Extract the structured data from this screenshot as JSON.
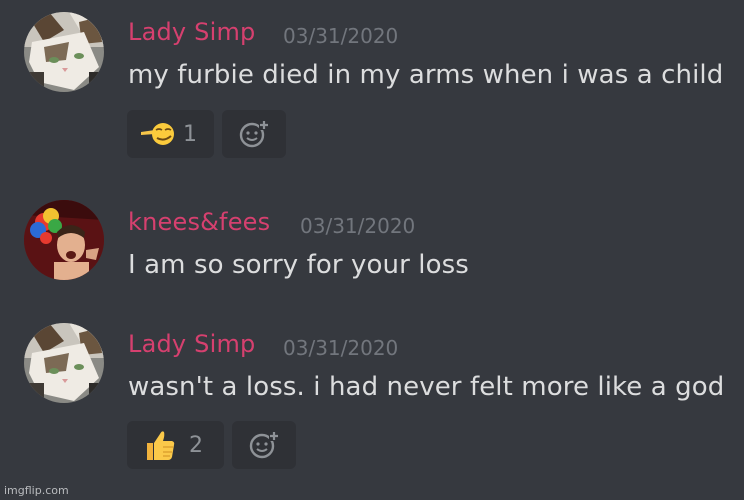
{
  "messages": [
    {
      "username": "Lady Simp",
      "timestamp": "03/31/2020",
      "content": "my furbie died in my arms when i was a child",
      "avatar": "cat-avatar",
      "reactions": [
        {
          "emoji": "smirking-face-emoji",
          "count": "1"
        }
      ]
    },
    {
      "username": "knees&fees",
      "timestamp": "03/31/2020",
      "content": "I am so sorry for your loss",
      "avatar": "clown-wig-person-avatar",
      "reactions": []
    },
    {
      "username": "Lady Simp",
      "timestamp": "03/31/2020",
      "content": "wasn't a loss. i had never felt more like a god",
      "avatar": "cat-avatar",
      "reactions": [
        {
          "emoji": "thumbs-up-emoji",
          "count": "2"
        }
      ]
    }
  ],
  "colors": {
    "background": "#36393f",
    "username": "#d6406f",
    "timestamp": "#72767d",
    "text": "#dcddde",
    "reaction_bg": "#2f3136",
    "reaction_count": "#8e9297"
  },
  "watermark": "imgflip.com"
}
